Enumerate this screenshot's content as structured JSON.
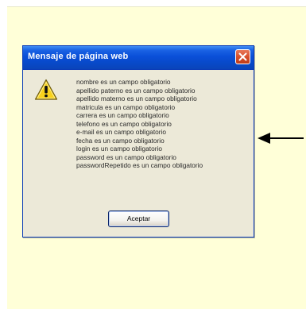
{
  "dialog": {
    "title": "Mensaje de página web",
    "icon": "warning-icon",
    "messages": [
      "nombre es un campo obligatorio",
      "apellido paterno es un campo obligatorio",
      "apellido materno es un campo obligatorio",
      "matricula es un campo obligatorio",
      "carrera es un campo obligatorio",
      "telefono es un campo obligatorio",
      "e-mail es un campo obligatorio",
      "fecha es un campo obligatorio",
      "login es un campo obligatorio",
      "password es un campo obligatorio",
      "passwordRepetido es un campo obligatorio"
    ],
    "ok_label": "Aceptar",
    "close_icon": "close-icon"
  },
  "annotation": {
    "icon": "left-arrow-icon"
  },
  "colors": {
    "page_background": "#ffffd8",
    "titlebar": "#0a4fd8",
    "dialog_body": "#ece9d8",
    "close_button": "#d8502c"
  }
}
